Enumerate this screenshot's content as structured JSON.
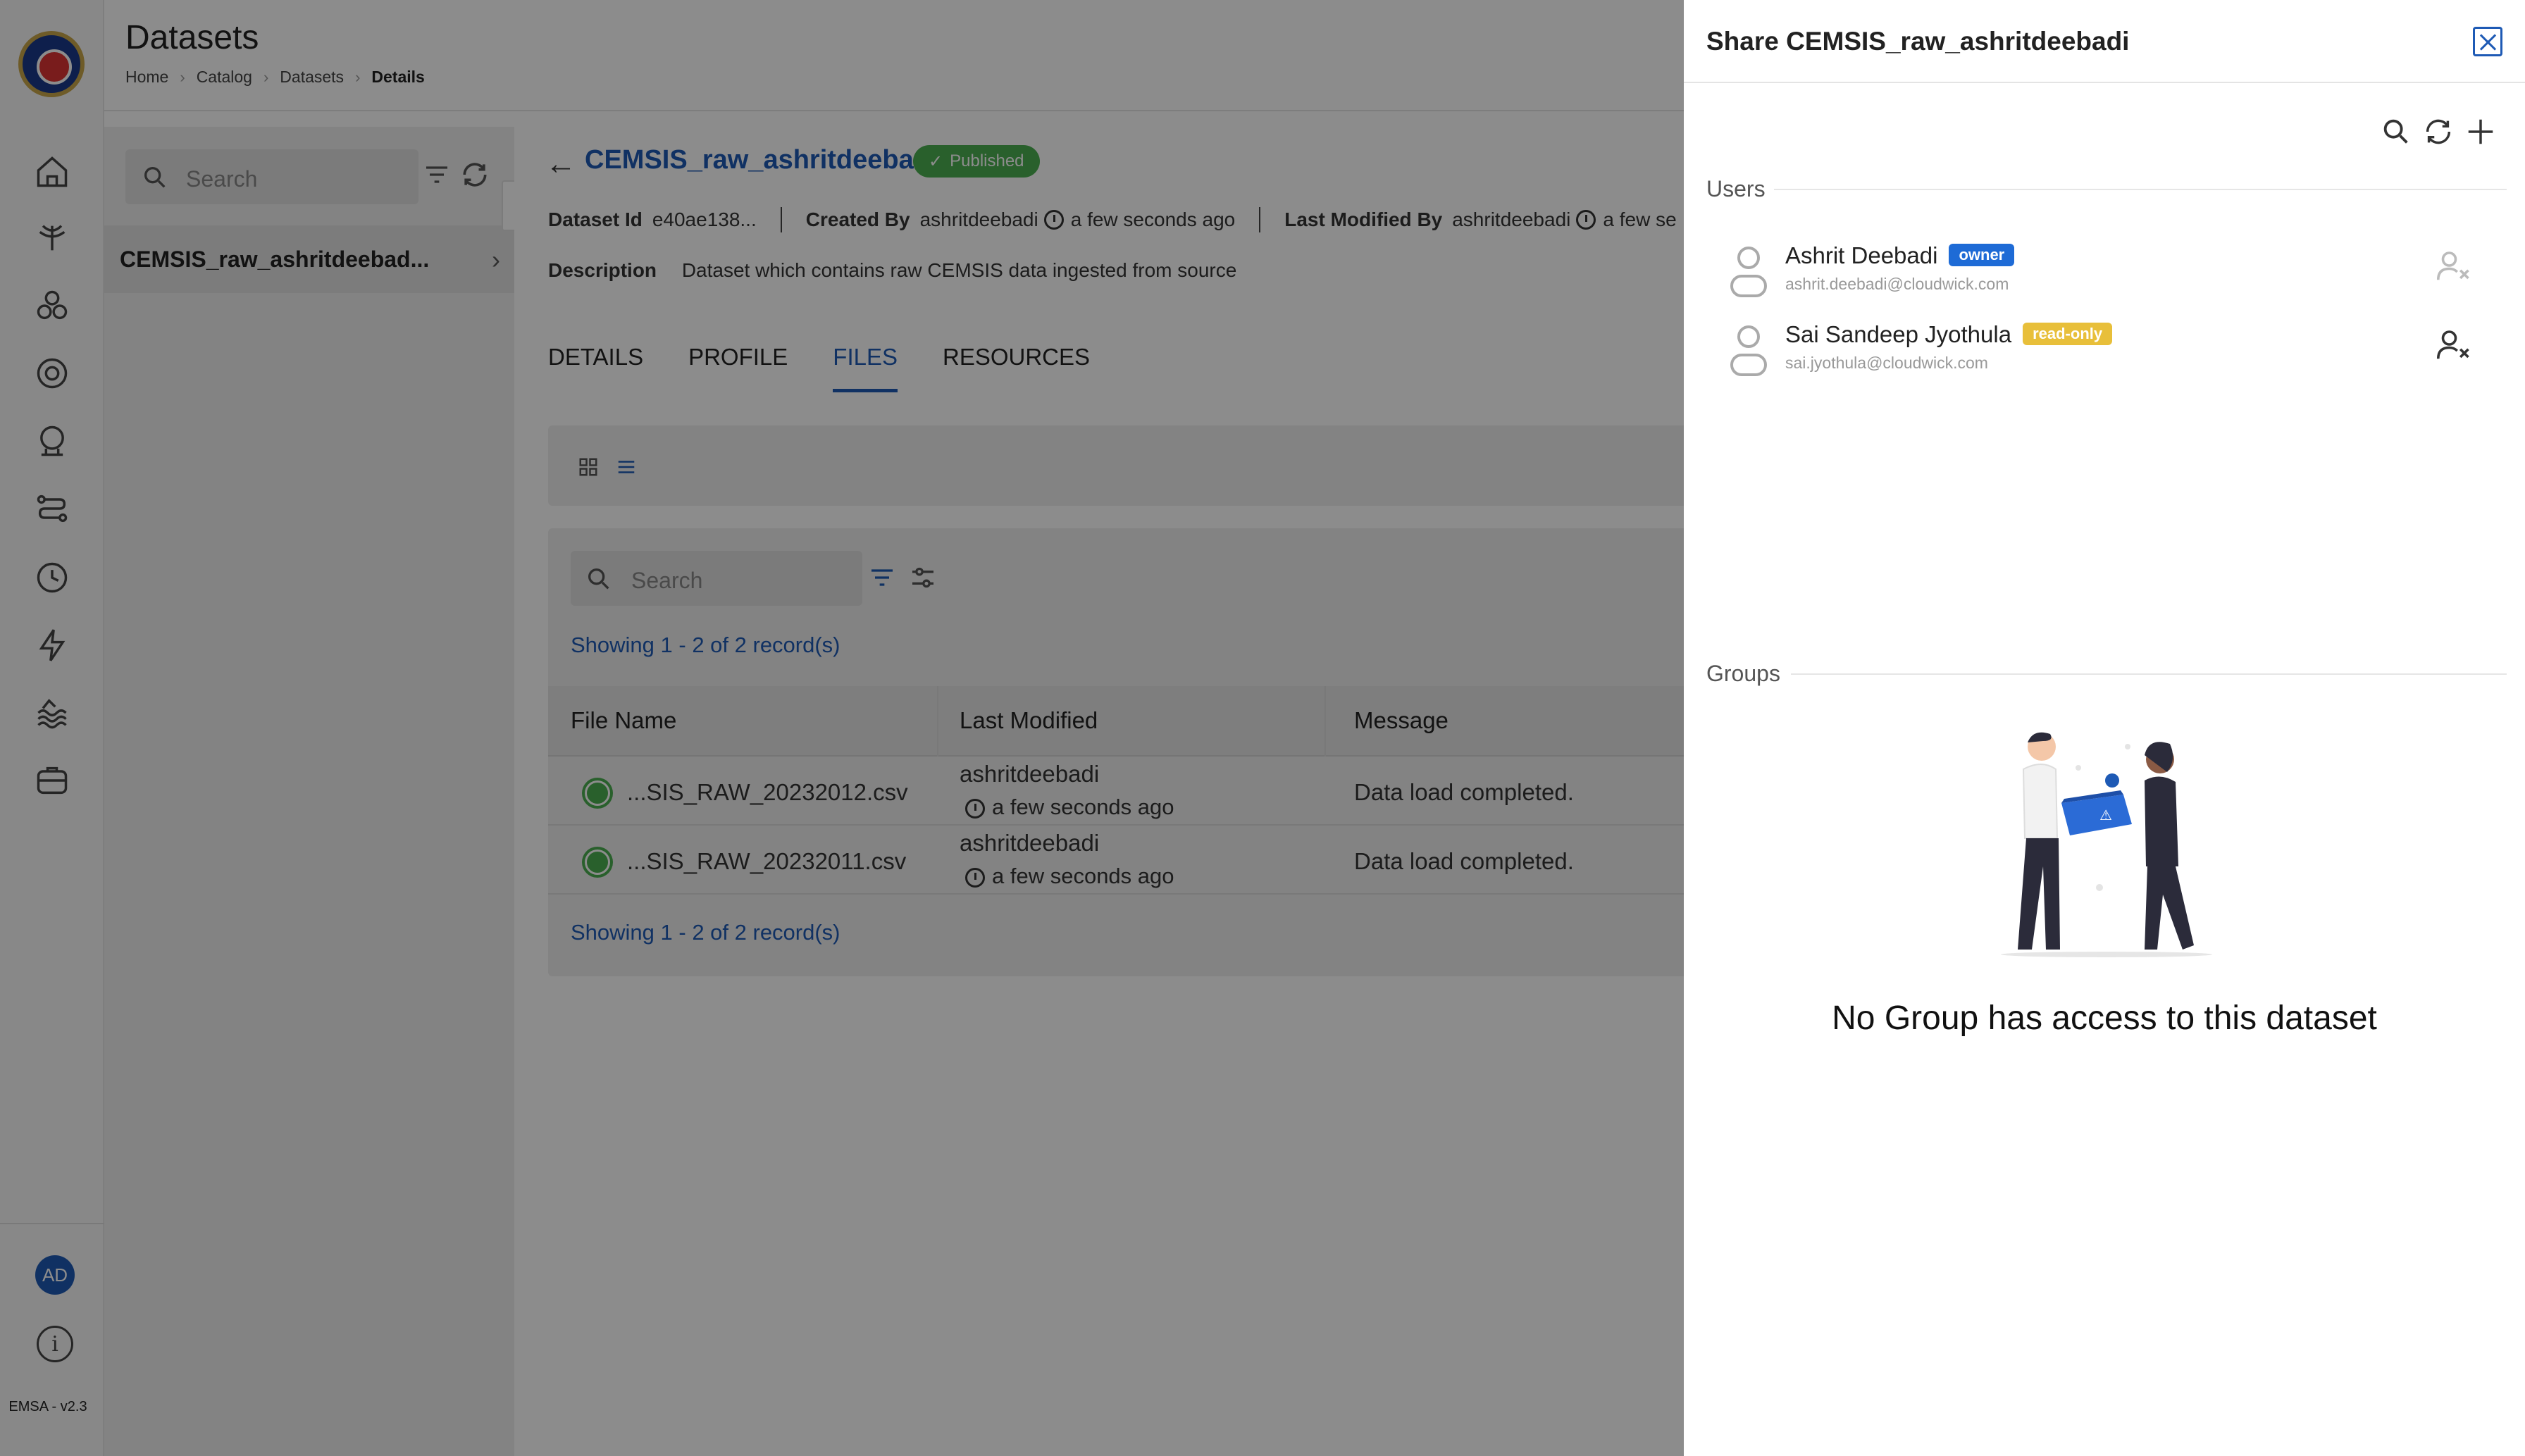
{
  "app": {
    "version": "EMSA - v2.3",
    "user_initials": "AD"
  },
  "sidebar": {
    "items": [
      {
        "name": "home-icon"
      },
      {
        "name": "ingestion-icon"
      },
      {
        "name": "catalog-icon"
      },
      {
        "name": "settings-icon"
      },
      {
        "name": "notebook-icon"
      },
      {
        "name": "pipeline-icon"
      },
      {
        "name": "schedule-icon"
      },
      {
        "name": "lightning-icon"
      },
      {
        "name": "lake-icon"
      },
      {
        "name": "storage-icon"
      }
    ]
  },
  "header": {
    "title": "Datasets",
    "breadcrumb": [
      "Home",
      "Catalog",
      "Datasets",
      "Details"
    ]
  },
  "left_panel": {
    "search_placeholder": "Search",
    "items": [
      {
        "label": "CEMSIS_raw_ashritdeebad..."
      }
    ]
  },
  "dataset": {
    "name": "CEMSIS_raw_ashritdeebadi",
    "status": "Published",
    "id_label": "Dataset Id",
    "id": "e40ae138...",
    "created_by_label": "Created By",
    "created_by": "ashritdeebadi",
    "created_when": "a few seconds ago",
    "modified_by_label": "Last Modified By",
    "modified_by": "ashritdeebadi",
    "modified_when": "a few se",
    "description_label": "Description",
    "description": "Dataset which contains raw CEMSIS data ingested from source"
  },
  "tabs": [
    {
      "label": "DETAILS",
      "active": false
    },
    {
      "label": "PROFILE",
      "active": false
    },
    {
      "label": "FILES",
      "active": true
    },
    {
      "label": "RESOURCES",
      "active": false
    }
  ],
  "files": {
    "search_placeholder": "Search",
    "showing": "Showing 1 - 2 of 2 record(s)",
    "columns": [
      "File Name",
      "Last Modified",
      "Message"
    ],
    "rows": [
      {
        "file": "...SIS_RAW_20232012.csv",
        "user": "ashritdeebadi",
        "when": "a few seconds ago",
        "message": "Data load completed."
      },
      {
        "file": "...SIS_RAW_20232011.csv",
        "user": "ashritdeebadi",
        "when": "a few seconds ago",
        "message": "Data load completed."
      }
    ]
  },
  "share": {
    "title": "Share CEMSIS_raw_ashritdeebadi",
    "users_label": "Users",
    "groups_label": "Groups",
    "users": [
      {
        "name": "Ashrit Deebadi",
        "role": "owner",
        "email": "ashrit.deebadi@cloudwick.com"
      },
      {
        "name": "Sai Sandeep Jyothula",
        "role": "read-only",
        "email": "sai.jyothula@cloudwick.com"
      }
    ],
    "empty_groups": "No Group has access to this dataset"
  },
  "colors": {
    "accent": "#1e5ab5",
    "published": "#4caf50",
    "owner_badge": "#1e6bd6",
    "readonly_badge": "#e8bf3a"
  }
}
